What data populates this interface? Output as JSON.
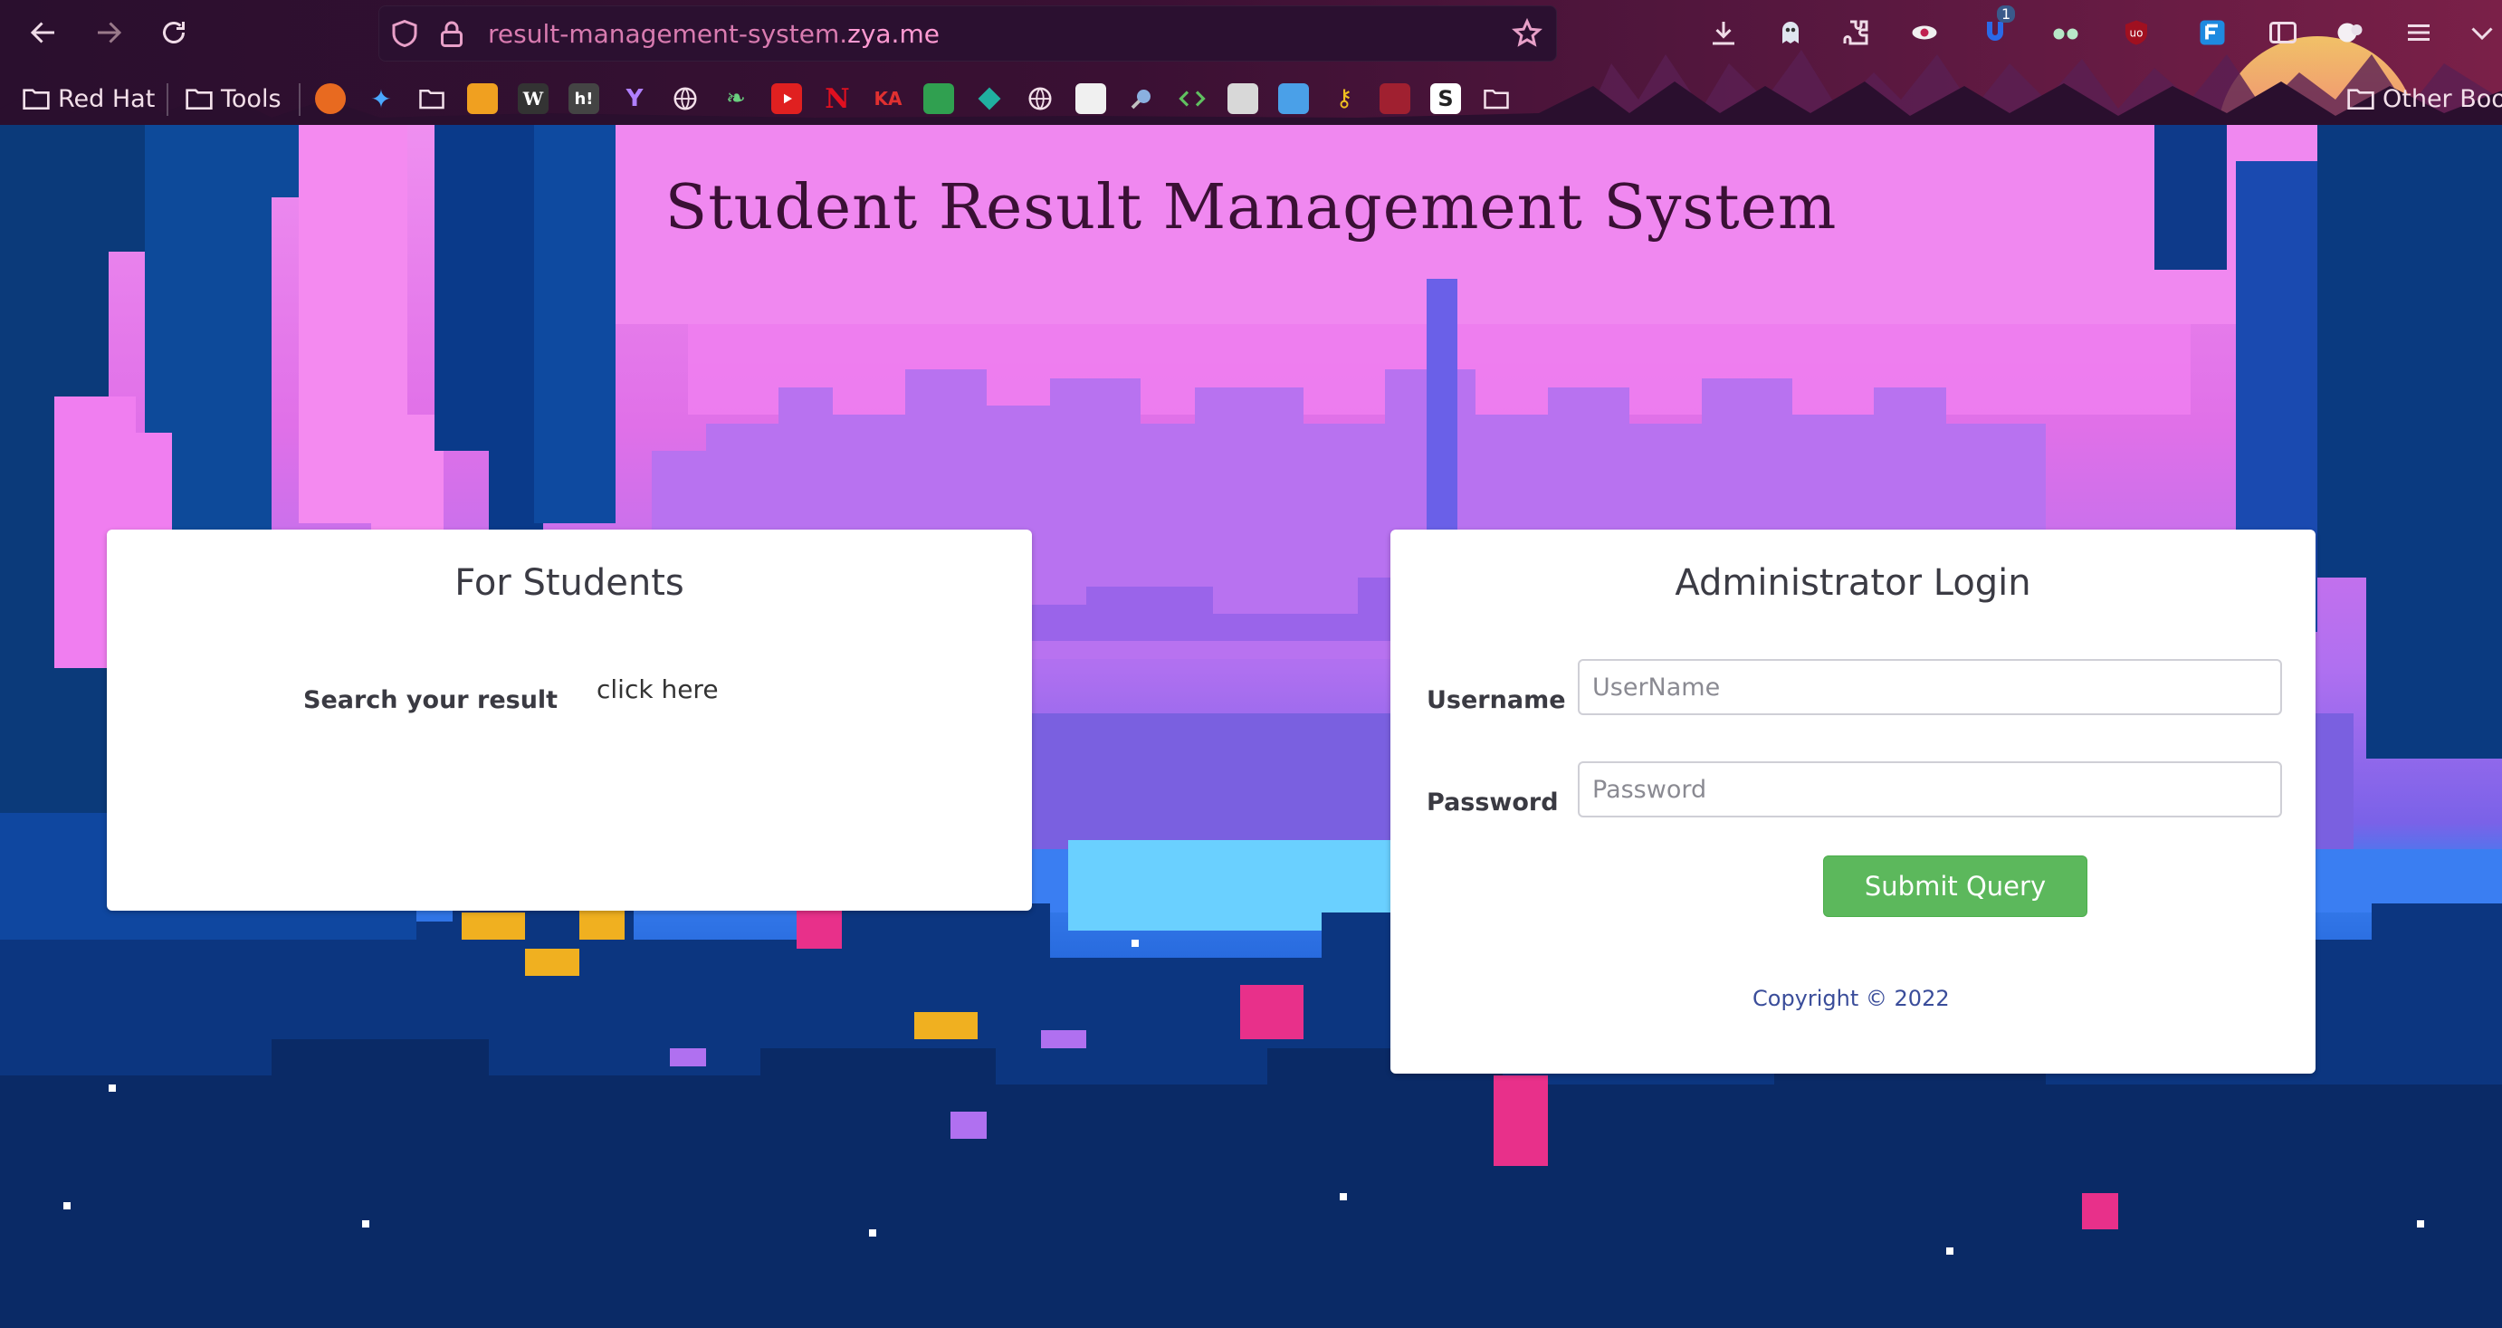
{
  "browser": {
    "url_prefix": "result-management-system.",
    "url_domain": "zya.me",
    "download_badge": "1",
    "bookmarks": [
      {
        "label": "Red Hat",
        "icon": "folder-icon"
      },
      {
        "label": "Tools",
        "icon": "folder-icon"
      }
    ],
    "bookmark_icon_glyphs": [
      "W",
      "h!",
      "Y",
      "KA",
      "S"
    ],
    "other_bookmarks": "Other Boo"
  },
  "page": {
    "title": "Student Result Management System",
    "student_card": {
      "title": "For Students",
      "search_label": "Search your result",
      "link_text": "click here"
    },
    "admin_card": {
      "title": "Administrator Login",
      "username_label": "Username",
      "username_placeholder": "UserName",
      "password_label": "Password",
      "password_placeholder": "Password",
      "submit_label": "Submit Query"
    },
    "copyright": "Copyright © 2022"
  },
  "colors": {
    "submit_button": "#5cb85c",
    "title_text": "#3a1035",
    "card_background": "#ffffff"
  }
}
